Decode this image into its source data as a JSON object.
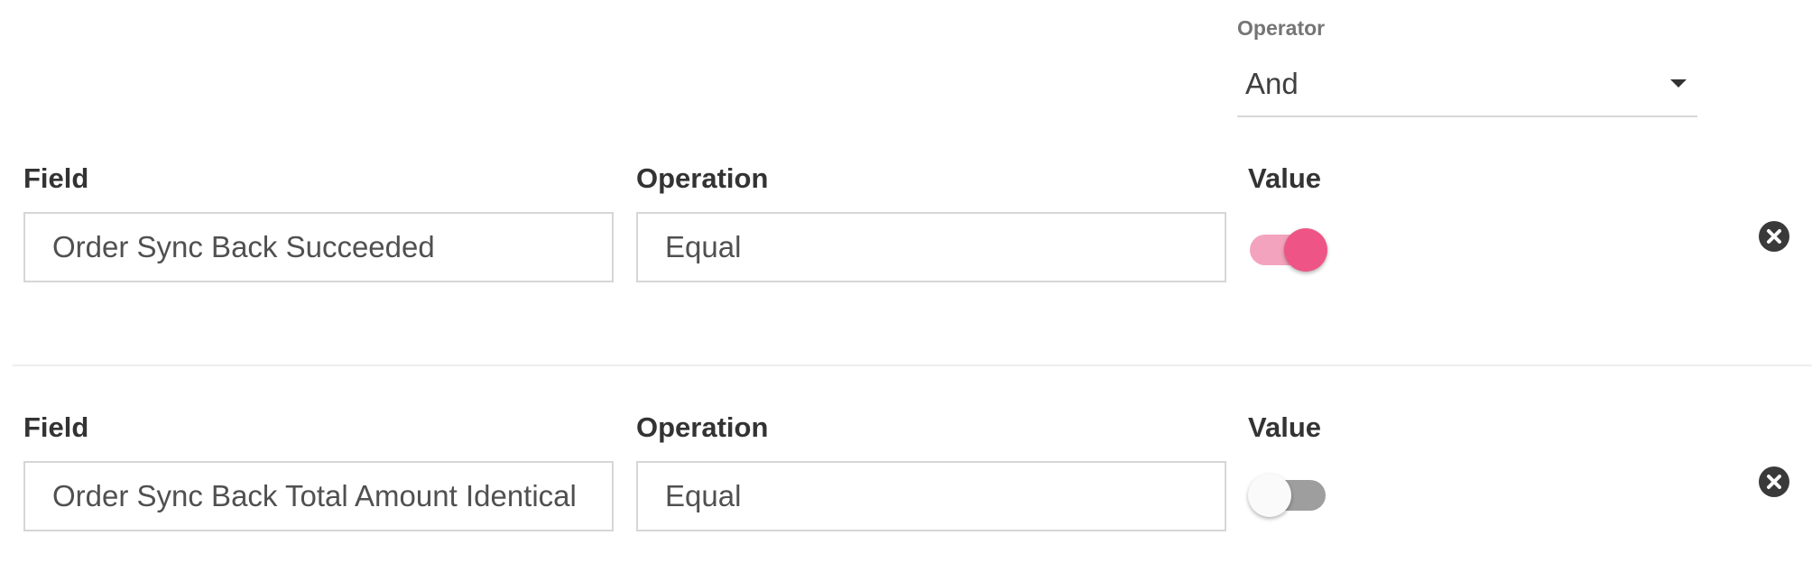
{
  "operator": {
    "label": "Operator",
    "value": "And",
    "icon": "caret-down-icon"
  },
  "conditions": [
    {
      "field_label": "Field",
      "field_value": "Order Sync Back Succeeded",
      "operation_label": "Operation",
      "operation_value": "Equal",
      "value_label": "Value",
      "value_on": true,
      "remove_icon": "close-circle-icon"
    },
    {
      "field_label": "Field",
      "field_value": "Order Sync Back Total Amount Identical",
      "operation_label": "Operation",
      "operation_value": "Equal",
      "value_label": "Value",
      "value_on": false,
      "remove_icon": "close-circle-icon"
    }
  ],
  "colors": {
    "toggle_on_knob": "#ee5586",
    "toggle_on_track": "#f4a3be",
    "toggle_off_knob": "#fafafa",
    "toggle_off_track": "#9e9e9e",
    "remove_button": "#3a3a3a"
  }
}
